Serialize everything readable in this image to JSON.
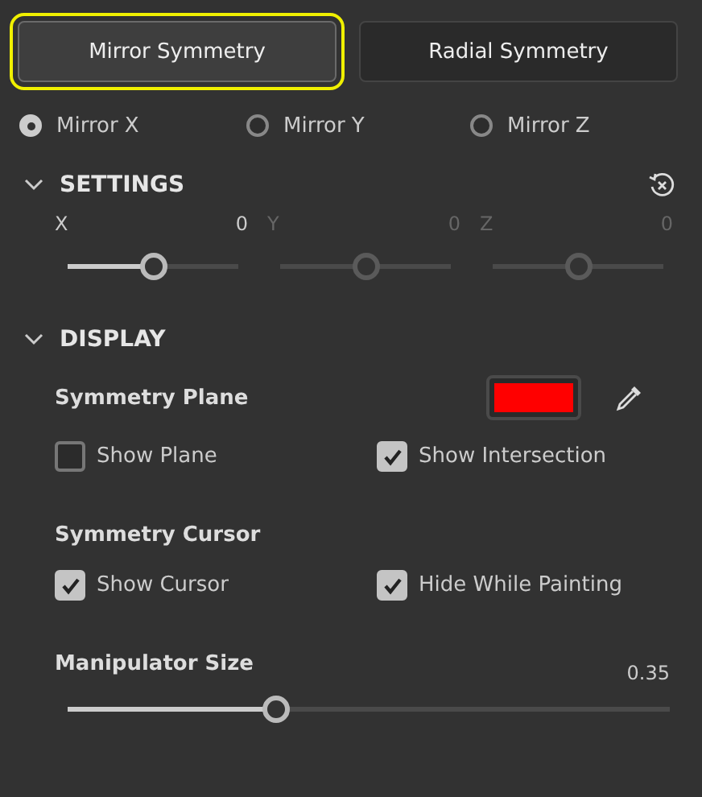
{
  "modes": [
    {
      "label": "Mirror Symmetry",
      "selected": true,
      "focused": true
    },
    {
      "label": "Radial Symmetry",
      "selected": false,
      "focused": false
    }
  ],
  "axes": [
    {
      "label": "Mirror X",
      "selected": true
    },
    {
      "label": "Mirror Y",
      "selected": false
    },
    {
      "label": "Mirror Z",
      "selected": false
    }
  ],
  "settings": {
    "title": "SETTINGS",
    "sliders": [
      {
        "label": "X",
        "reading": "0",
        "level": 0.5,
        "disabled": false
      },
      {
        "label": "Y",
        "reading": "0",
        "level": 0.5,
        "disabled": true
      },
      {
        "label": "Z",
        "reading": "0",
        "level": 0.5,
        "disabled": true
      }
    ]
  },
  "display": {
    "title": "DISPLAY",
    "plane_label": "Symmetry Plane",
    "plane_options": [
      {
        "label": "Show Plane",
        "checked": false
      },
      {
        "label": "Show Intersection",
        "checked": true
      }
    ],
    "cursor_label": "Symmetry Cursor",
    "cursor_options": [
      {
        "label": "Show Cursor",
        "checked": true
      },
      {
        "label": "Hide While Painting",
        "checked": true
      }
    ],
    "size": {
      "label": "Manipulator Size",
      "reading": "0.35",
      "level": 0.33
    }
  }
}
